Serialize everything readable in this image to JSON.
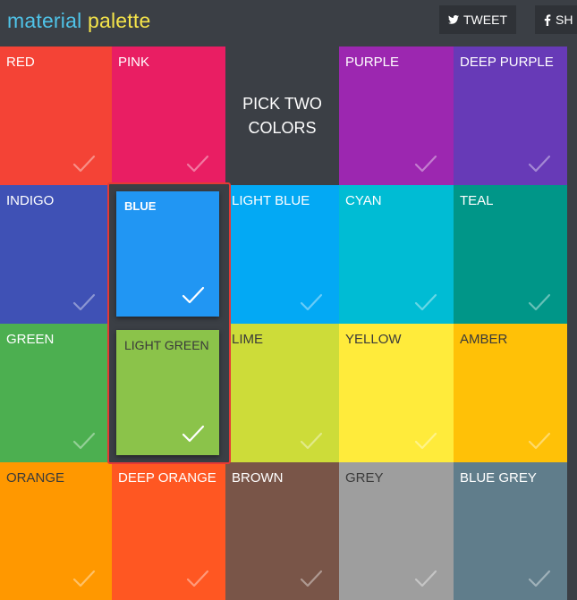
{
  "app": {
    "logo_part1": "material",
    "logo_part2": "palette"
  },
  "header": {
    "tweet_label": "TWEET",
    "share_label": "SH"
  },
  "pick_prompt": {
    "line1": "PICK TWO",
    "line2": "COLORS"
  },
  "colors": [
    {
      "label": "RED",
      "color": "#f44336"
    },
    {
      "label": "PINK",
      "color": "#e91e63"
    },
    {
      "label": "PURPLE",
      "color": "#9c27b0"
    },
    {
      "label": "DEEP PURPLE",
      "color": "#673ab7"
    },
    {
      "label": "INDIGO",
      "color": "#3f51b5"
    },
    {
      "label": "LIGHT BLUE",
      "color": "#03a9f4"
    },
    {
      "label": "CYAN",
      "color": "#00bcd4"
    },
    {
      "label": "TEAL",
      "color": "#009688"
    },
    {
      "label": "GREEN",
      "color": "#4caf50"
    },
    {
      "label": "LIME",
      "color": "#cddc39"
    },
    {
      "label": "YELLOW",
      "color": "#ffeb3b"
    },
    {
      "label": "AMBER",
      "color": "#ffc107"
    },
    {
      "label": "ORANGE",
      "color": "#ff9800"
    },
    {
      "label": "DEEP ORANGE",
      "color": "#ff5722"
    },
    {
      "label": "BROWN",
      "color": "#795548"
    },
    {
      "label": "GREY",
      "color": "#9e9e9e"
    },
    {
      "label": "BLUE GREY",
      "color": "#607d8b"
    }
  ],
  "selected": [
    {
      "label": "BLUE",
      "color": "#2196f3"
    },
    {
      "label": "LIGHT GREEN",
      "color": "#8bc34a"
    }
  ]
}
